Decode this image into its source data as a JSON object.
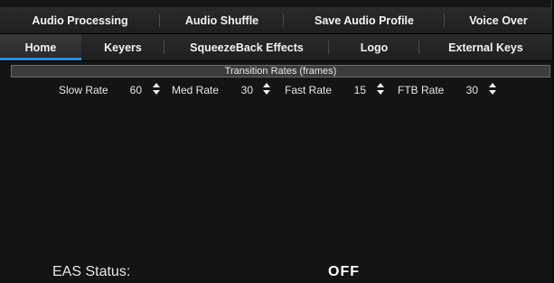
{
  "top_tabs": [
    {
      "label": "Audio Processing"
    },
    {
      "label": "Audio Shuffle"
    },
    {
      "label": "Save Audio Profile"
    },
    {
      "label": "Voice Over"
    }
  ],
  "sub_tabs": [
    {
      "label": "Home",
      "active": true
    },
    {
      "label": "Keyers"
    },
    {
      "label": "SqueezeBack Effects"
    },
    {
      "label": "Logo"
    },
    {
      "label": "External Keys"
    }
  ],
  "section": {
    "title": "Transition Rates (frames)"
  },
  "rates": [
    {
      "label": "Slow Rate",
      "value": "60"
    },
    {
      "label": "Med Rate",
      "value": "30"
    },
    {
      "label": "Fast Rate",
      "value": "15"
    },
    {
      "label": "FTB Rate",
      "value": "30"
    }
  ],
  "eas": {
    "label": "EAS Status:",
    "value": "OFF"
  },
  "colors": {
    "accent": "#2f8fd6",
    "background": "#141414",
    "tab_bar": "#262626"
  },
  "icons": {
    "spinner": "up-down-spinner-icon"
  }
}
